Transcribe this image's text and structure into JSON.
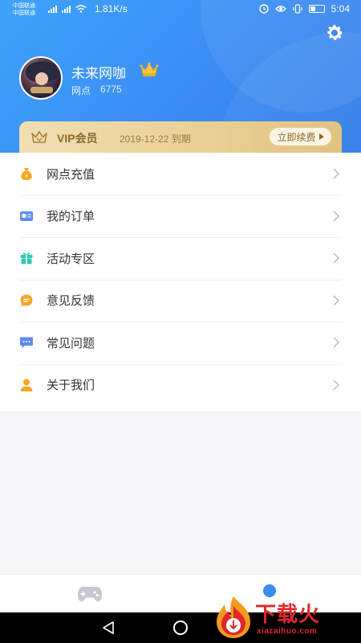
{
  "status_bar": {
    "carrier_1": "中国联通",
    "carrier_2": "中国联通",
    "speed": "1.81K/s",
    "time": "5:04"
  },
  "profile": {
    "username": "未来网咖",
    "points_label": "网点",
    "points_value": "6775"
  },
  "vip": {
    "title": "VIP会员",
    "expiry": "2019-12-22 到期",
    "renew_label": "立即续费"
  },
  "menu": {
    "items": [
      {
        "label": "网点充值",
        "icon": "coin-bag-icon",
        "color": "#f5a623"
      },
      {
        "label": "我的订单",
        "icon": "order-card-icon",
        "color": "#5b8def"
      },
      {
        "label": "活动专区",
        "icon": "gift-icon",
        "color": "#2fc6b0"
      },
      {
        "label": "意见反馈",
        "icon": "feedback-bubble-icon",
        "color": "#f5a623"
      },
      {
        "label": "常见问题",
        "icon": "faq-chat-icon",
        "color": "#5b8def"
      },
      {
        "label": "关于我们",
        "icon": "person-icon",
        "color": "#f5a623"
      }
    ]
  },
  "watermark": {
    "text": "下载火",
    "url": "xiazaihuo.com"
  },
  "colors": {
    "header_blue": "#3b8cf3",
    "vip_gold": "#e8cf93",
    "accent_orange": "#f5a623",
    "accent_blue": "#5b8def",
    "accent_teal": "#2fc6b0"
  }
}
